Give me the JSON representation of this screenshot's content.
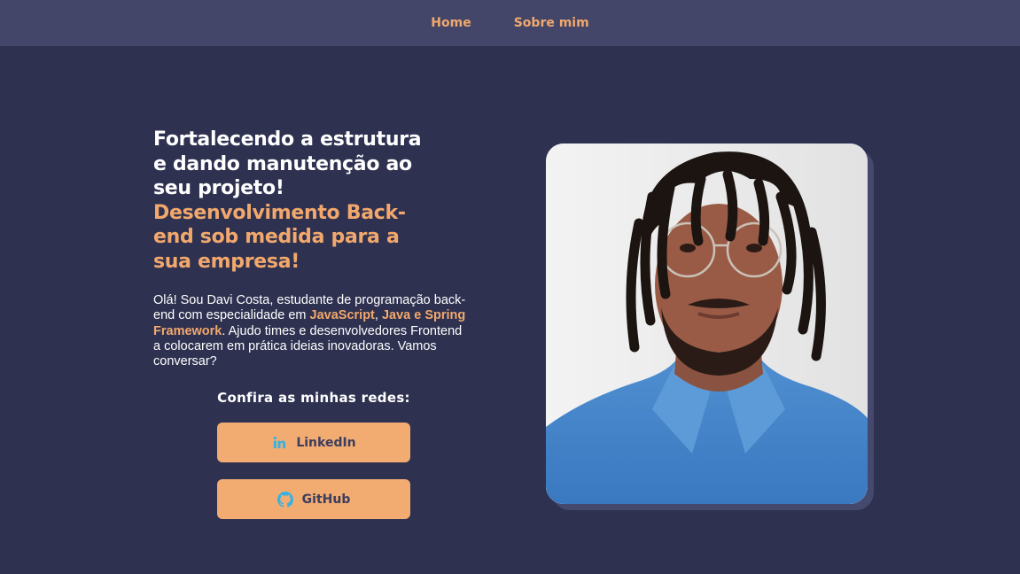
{
  "nav": {
    "home": "Home",
    "about": "Sobre mim"
  },
  "hero": {
    "headline_white": [
      "Fortalecendo a estrutura",
      "e dando manutenção ao",
      "seu projeto!"
    ],
    "headline_orange": [
      "Desenvolvimento Back-",
      "end sob medida para a",
      "sua empresa!"
    ],
    "intro": {
      "part1": "Olá! Sou Davi Costa, estudante de programação back-end com especialidade em ",
      "hl1": "JavaScript",
      "sep": ", ",
      "hl2": "Java e Spring Framework",
      "part2": ". Ajudo times e desenvolvedores Frontend a colocarem em prática ideias inovadoras. Vamos conversar?"
    }
  },
  "socials": {
    "title": "Confira as minhas redes:",
    "buttons": [
      {
        "label": "LinkedIn",
        "icon": "linkedin-icon"
      },
      {
        "label": "GitHub",
        "icon": "github-icon"
      }
    ]
  },
  "photo": {
    "subject": "profile-photo"
  },
  "colors": {
    "background": "#2e3150",
    "navbar": "#434669",
    "accent": "#f2a86c",
    "button": "#f2ac72",
    "icon": "#35b2e0"
  }
}
